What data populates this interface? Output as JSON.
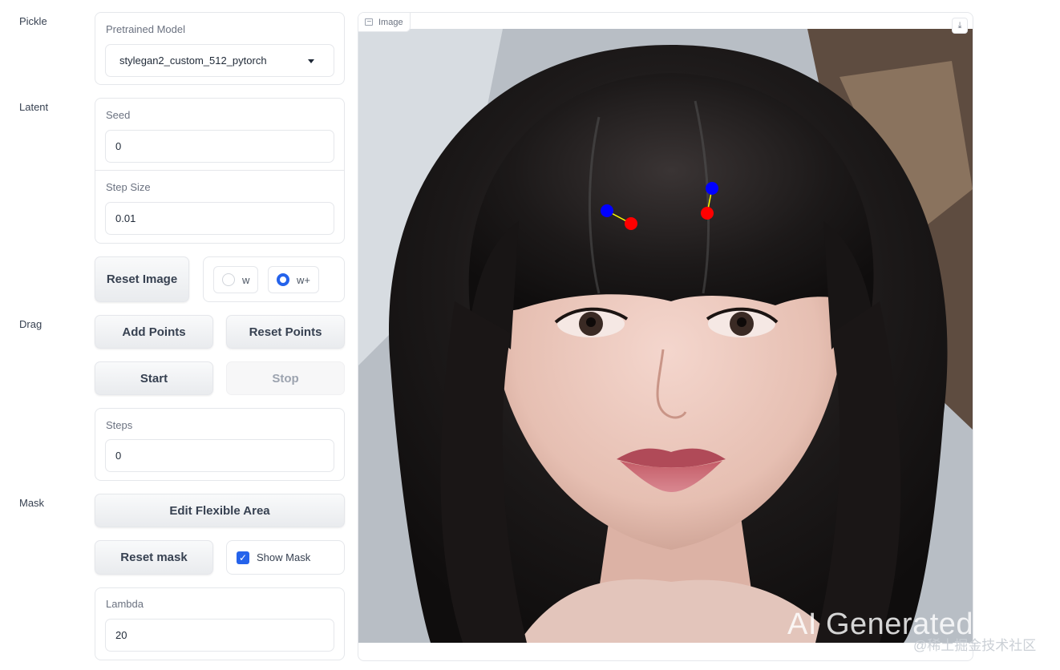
{
  "sections": {
    "pickle": "Pickle",
    "latent": "Latent",
    "drag": "Drag",
    "mask": "Mask"
  },
  "pickle": {
    "pretrained_label": "Pretrained Model",
    "pretrained_value": "stylegan2_custom_512_pytorch"
  },
  "latent": {
    "seed_label": "Seed",
    "seed_value": "0",
    "step_size_label": "Step Size",
    "step_size_value": "0.01",
    "reset_image_label": "Reset Image",
    "space_options": [
      {
        "label": "w",
        "checked": false
      },
      {
        "label": "w+",
        "checked": true
      }
    ]
  },
  "drag": {
    "add_points_label": "Add Points",
    "reset_points_label": "Reset Points",
    "start_label": "Start",
    "stop_label": "Stop",
    "steps_label": "Steps",
    "steps_value": "0"
  },
  "mask": {
    "edit_area_label": "Edit Flexible Area",
    "reset_mask_label": "Reset mask",
    "show_mask_label": "Show Mask",
    "show_mask_checked": true,
    "lambda_label": "Lambda",
    "lambda_value": "20"
  },
  "image": {
    "tag_label": "Image",
    "watermark": "AI Generated",
    "site_watermark": "@稀土掘金技术社区",
    "handle_color": "#0000ff",
    "target_color": "#ff0000",
    "line_color": "#ffff00"
  }
}
